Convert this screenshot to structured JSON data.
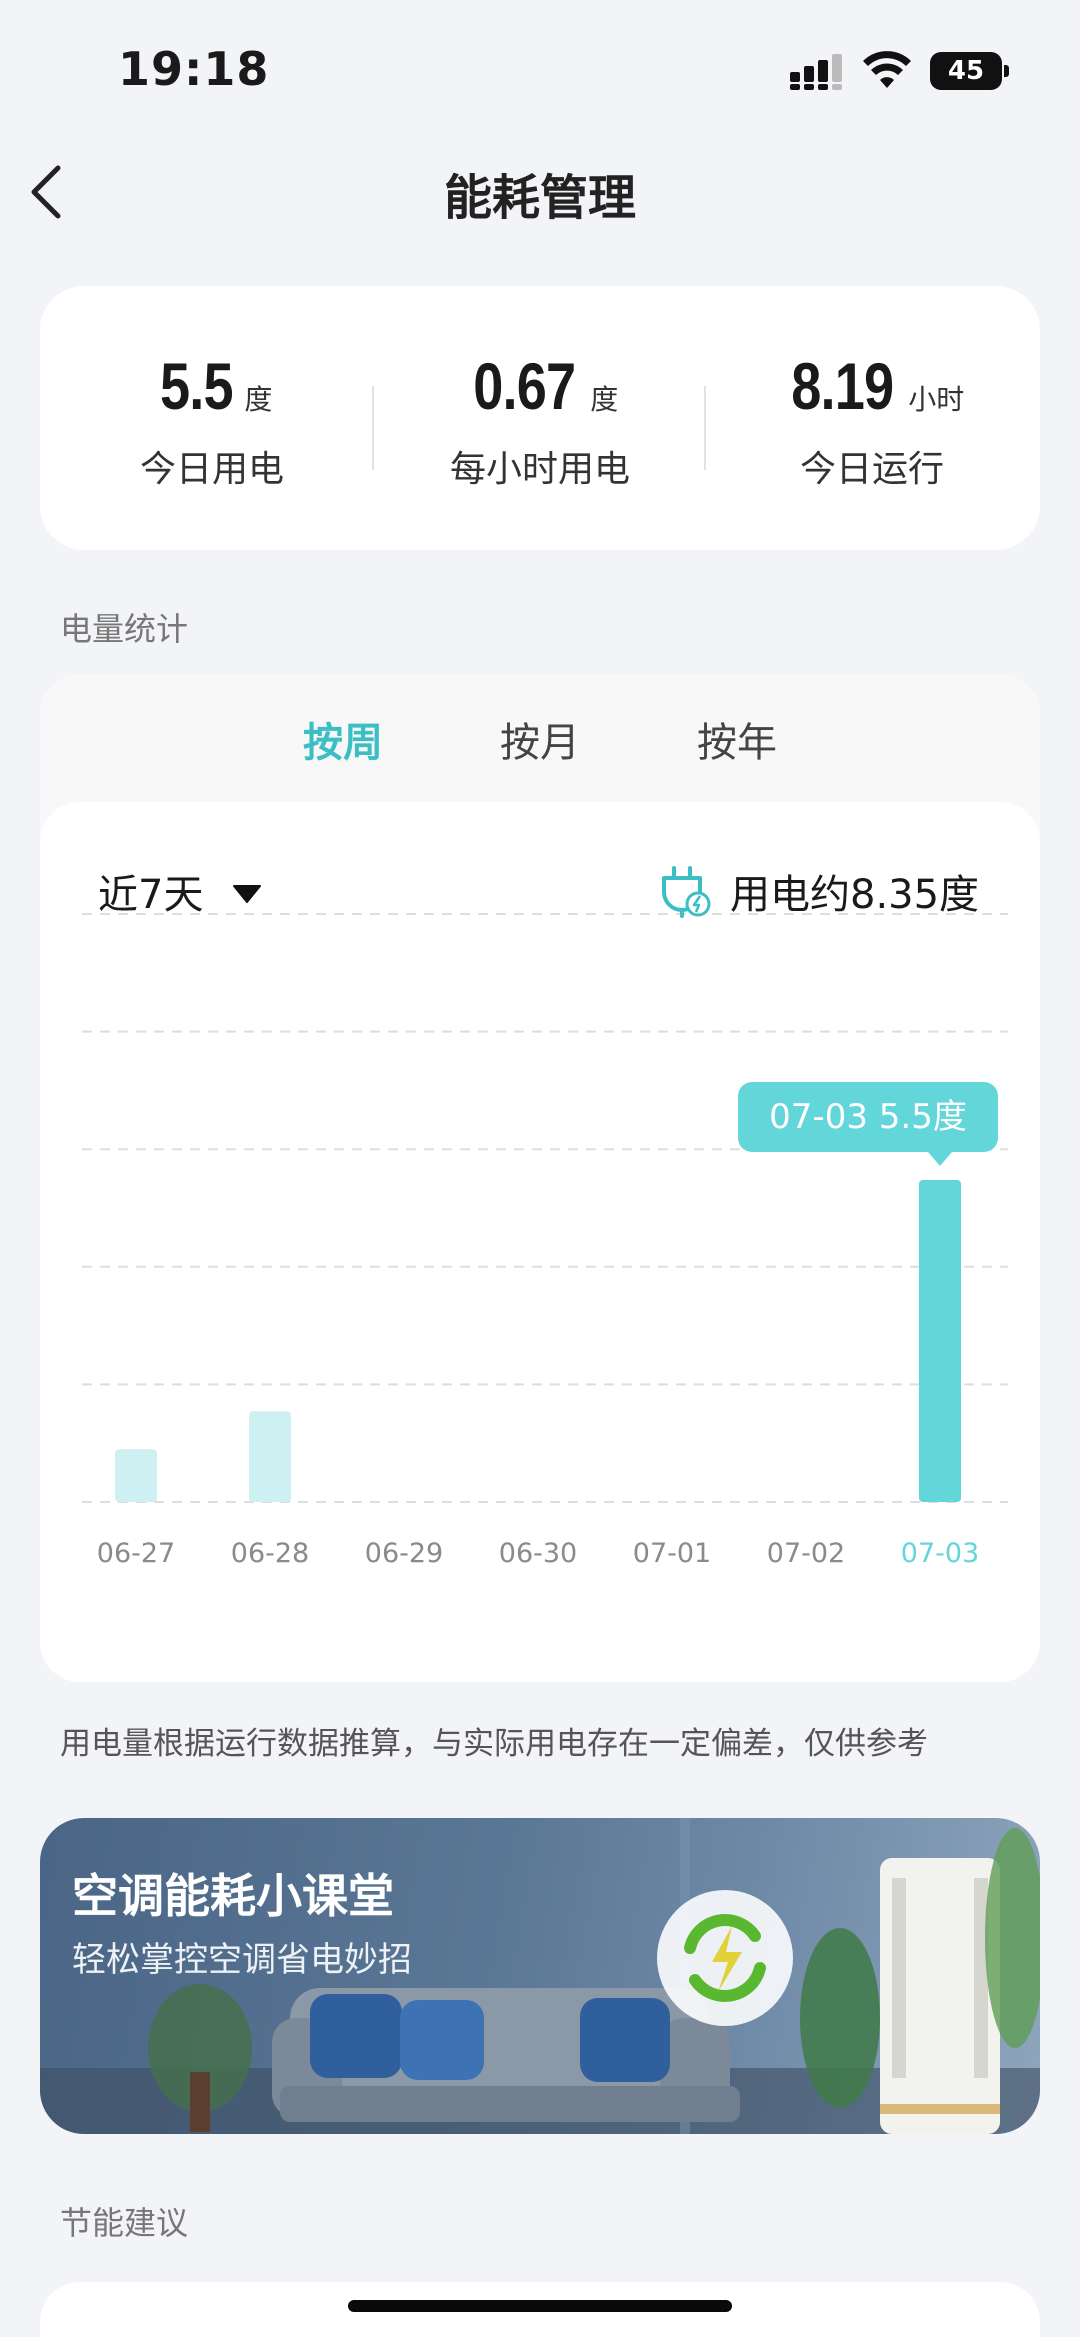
{
  "status_bar": {
    "time": "19:18",
    "battery": "45"
  },
  "header": {
    "title": "能耗管理"
  },
  "summary": [
    {
      "value": "5.5",
      "unit": "度",
      "label": "今日用电"
    },
    {
      "value": "0.67",
      "unit": "度",
      "label": "每小时用电"
    },
    {
      "value": "8.19",
      "unit": "小时",
      "label": "今日运行"
    }
  ],
  "stats_section": {
    "title": "电量统计"
  },
  "tabs": [
    {
      "label": "按周",
      "active": true
    },
    {
      "label": "按月",
      "active": false
    },
    {
      "label": "按年",
      "active": false
    }
  ],
  "range": {
    "selected": "近7天"
  },
  "usage_total": "用电约8.35度",
  "tooltip": "07-03 5.5度",
  "chart_data": {
    "type": "bar",
    "categories": [
      "06-27",
      "06-28",
      "06-29",
      "06-30",
      "07-01",
      "07-02",
      "07-03"
    ],
    "values": [
      0.9,
      1.55,
      0,
      0,
      0,
      0,
      5.5
    ],
    "highlighted_index": 6,
    "ylim": [
      0,
      10
    ],
    "grid": true,
    "colors": {
      "bar": "#cdf0f2",
      "highlight": "#63d6d9",
      "grid": "#dddddd"
    }
  },
  "disclaimer": "用电量根据运行数据推算，与实际用电存在一定偏差，仅供参考",
  "banner": {
    "title": "空调能耗小课堂",
    "subtitle": "轻松掌控空调省电妙招"
  },
  "advice_section": {
    "title": "节能建议"
  },
  "colors": {
    "accent": "#3bbfc4",
    "background": "#f3f4f7"
  }
}
